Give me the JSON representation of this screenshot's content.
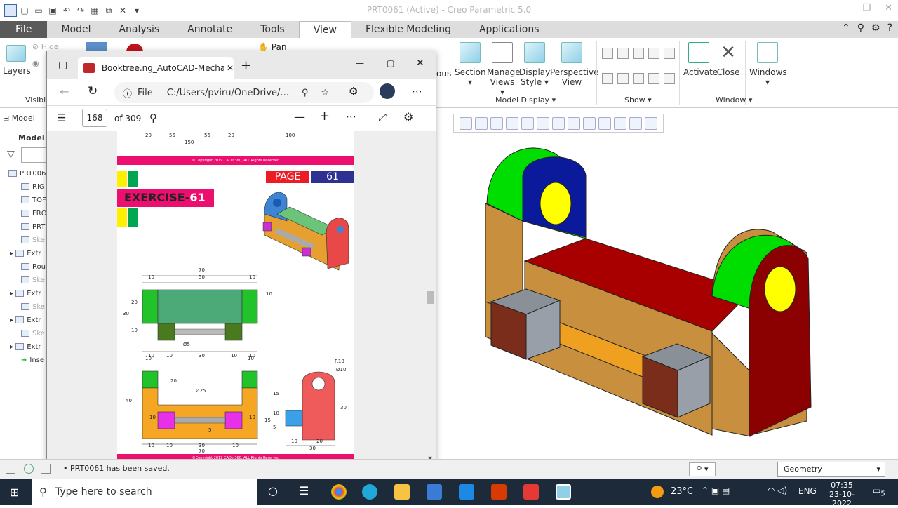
{
  "app": {
    "title": "PRT0061 (Active) - Creo Parametric 5.0"
  },
  "ribbon_tabs": [
    "File",
    "Model",
    "Analysis",
    "Annotate",
    "Tools",
    "View",
    "Flexible Modeling",
    "Applications"
  ],
  "ribbon": {
    "layers_label": "Layers",
    "hide_label": "Hide",
    "visibility_label": "Visibil",
    "pan_label": "Pan",
    "ous_label": "ous",
    "section": "Section",
    "manage_views": "Manage Views",
    "display_style": "Display Style",
    "perspective_view": "Perspective View",
    "model_display_group": "Model Display",
    "show_group": "Show",
    "activate": "Activate",
    "close": "Close",
    "windows": "Windows",
    "window_group": "Window"
  },
  "tree": {
    "header": "Model",
    "header2": "Model T",
    "items": [
      "PRT006",
      "RIG",
      "TOF",
      "FRO",
      "PRT",
      "Ske",
      "Extr",
      "Rou",
      "Ske",
      "Extr",
      "Ske",
      "Extr",
      "Ske",
      "Extr",
      "Inse"
    ]
  },
  "browser": {
    "tab_title": "Booktree.ng_AutoCAD-Mechanic",
    "file_label": "File",
    "url": "C:/Users/pviru/OneDrive/...",
    "page_current": "168",
    "page_total": "of 309"
  },
  "pdf": {
    "copyright": "©Copyright 2019 CADin360, ALL Rights Reserved",
    "page_label": "PAGE",
    "page_number": "61",
    "exercise_label": "EXERCISE-",
    "exercise_number": "61",
    "top_dims": [
      "20",
      "55",
      "55",
      "20",
      "150",
      "100"
    ],
    "front_dims": [
      "70",
      "10",
      "50",
      "10",
      "10",
      "20",
      "30",
      "10",
      "Ø5",
      "10",
      "10",
      "30",
      "10",
      "10"
    ],
    "side_dims": [
      "10",
      "10",
      "20",
      "Ø25",
      "40",
      "10",
      "5",
      "10",
      "10",
      "30",
      "10",
      "10",
      "70"
    ],
    "right_dims": [
      "R10",
      "Ø10",
      "15",
      "10",
      "15",
      "5",
      "30",
      "10",
      "20",
      "30"
    ]
  },
  "status": {
    "message": "PRT0061 has been saved.",
    "filter": "Geometry"
  },
  "taskbar": {
    "search_placeholder": "Type here to search",
    "temperature": "23°C",
    "language": "ENG",
    "time": "07:35",
    "date": "23-10-2022",
    "notifications": "5"
  }
}
